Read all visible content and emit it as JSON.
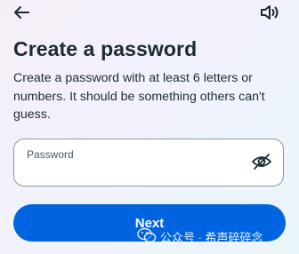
{
  "header": {
    "back_icon": "arrow-left-icon",
    "sound_icon": "speaker-volume-icon"
  },
  "title": "Create a password",
  "description": "Create a password with at least 6 letters or numbers. It should be something others can't guess.",
  "password_field": {
    "label": "Password",
    "value": "",
    "toggle_icon": "eye-slash-icon"
  },
  "next_button": {
    "label": "Next",
    "color": "#0064e0"
  },
  "watermark": {
    "icon": "wechat-icon",
    "text": "公众号 · 希声碎碎念"
  }
}
